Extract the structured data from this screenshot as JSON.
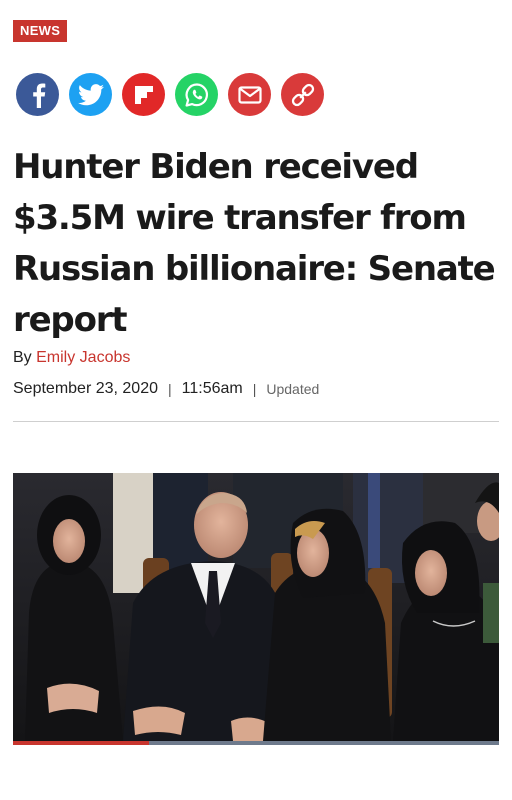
{
  "section_label": "NEWS",
  "share": [
    {
      "name": "facebook",
      "color": "#3b5998"
    },
    {
      "name": "twitter",
      "color": "#1da1f2"
    },
    {
      "name": "flipboard",
      "color": "#e12828"
    },
    {
      "name": "whatsapp",
      "color": "#25d366"
    },
    {
      "name": "email",
      "color": "#d93a3a"
    },
    {
      "name": "copy-link",
      "color": "#d93a3a"
    }
  ],
  "headline": "Hunter Biden received $3.5M wire transfer from Russian billionaire: Senate report",
  "byline": {
    "prefix": "By",
    "author": "Emily Jacobs"
  },
  "meta": {
    "date": "September 23, 2020",
    "separator": "|",
    "time": "11:56am",
    "updated": "Updated"
  },
  "media": {
    "image": "photo of a man in a dark suit seated among women in black headscarves at a ceremony"
  },
  "progress": 0.28,
  "colors": {
    "accent": "#c8352e",
    "progress_track": "#6e7a8c"
  }
}
